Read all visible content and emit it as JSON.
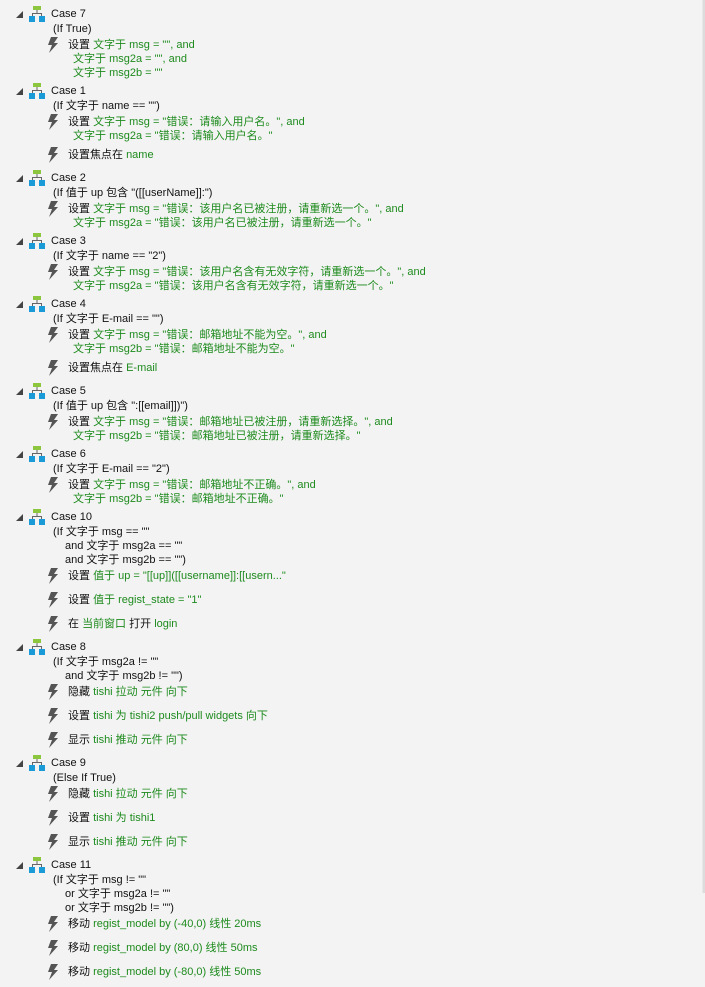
{
  "colors": {
    "background": "#f3f3f3",
    "keyword": "#111111",
    "value": "#1e8b1e",
    "case_icon_top": "#8cc63f",
    "case_icon_bottom": "#1a9ad6",
    "bolt": "#555555"
  },
  "cases": [
    {
      "label": "Case 7",
      "condition": [
        "(If True)"
      ],
      "actions": [
        {
          "lines": [
            [
              {
                "t": "设置 ",
                "c": "k"
              },
              {
                "t": "文字于 msg = \"\", and",
                "c": "g"
              }
            ],
            [
              {
                "t": " 文字于 msg2a = \"\", and",
                "c": "g"
              }
            ],
            [
              {
                "t": " 文字于 msg2b = \"\"",
                "c": "g"
              }
            ]
          ]
        }
      ]
    },
    {
      "label": "Case 1",
      "condition": [
        "(If 文字于 name == \"\")"
      ],
      "actions": [
        {
          "lines": [
            [
              {
                "t": "设置 ",
                "c": "k"
              },
              {
                "t": "文字于 msg = \"错误：请输入用户名。\", and",
                "c": "g"
              }
            ],
            [
              {
                "t": " 文字于 msg2a = \"错误：请输入用户名。\"",
                "c": "g"
              }
            ]
          ]
        },
        {
          "lines": [
            [
              {
                "t": "设置焦点在 ",
                "c": "k"
              },
              {
                "t": "name",
                "c": "g"
              }
            ]
          ]
        }
      ]
    },
    {
      "label": "Case 2",
      "condition": [
        "(If 值于 up 包含 \"([[userName]]:\")"
      ],
      "actions": [
        {
          "lines": [
            [
              {
                "t": "设置 ",
                "c": "k"
              },
              {
                "t": "文字于 msg = \"错误：该用户名已被注册，请重新选一个。\", and",
                "c": "g"
              }
            ],
            [
              {
                "t": " 文字于 msg2a = \"错误：该用户名已被注册，请重新选一个。\"",
                "c": "g"
              }
            ]
          ]
        }
      ]
    },
    {
      "label": "Case 3",
      "condition": [
        "(If 文字于 name == \"2\")"
      ],
      "actions": [
        {
          "lines": [
            [
              {
                "t": "设置 ",
                "c": "k"
              },
              {
                "t": "文字于 msg = \"错误：该用户名含有无效字符，请重新选一个。\", and",
                "c": "g"
              }
            ],
            [
              {
                "t": " 文字于 msg2a = \"错误：该用户名含有无效字符，请重新选一个。\"",
                "c": "g"
              }
            ]
          ]
        }
      ]
    },
    {
      "label": "Case 4",
      "condition": [
        "(If 文字于 E-mail == \"\")"
      ],
      "actions": [
        {
          "lines": [
            [
              {
                "t": "设置 ",
                "c": "k"
              },
              {
                "t": "文字于 msg = \"错误：邮箱地址不能为空。\", and",
                "c": "g"
              }
            ],
            [
              {
                "t": " 文字于 msg2b = \"错误：邮箱地址不能为空。\"",
                "c": "g"
              }
            ]
          ]
        },
        {
          "lines": [
            [
              {
                "t": "设置焦点在 ",
                "c": "k"
              },
              {
                "t": "E-mail",
                "c": "g"
              }
            ]
          ]
        }
      ]
    },
    {
      "label": "Case 5",
      "condition": [
        "(If 值于 up 包含 \":[[email]])\")"
      ],
      "actions": [
        {
          "lines": [
            [
              {
                "t": "设置 ",
                "c": "k"
              },
              {
                "t": "文字于 msg = \"错误：邮箱地址已被注册，请重新选择。\", and",
                "c": "g"
              }
            ],
            [
              {
                "t": " 文字于 msg2b = \"错误：邮箱地址已被注册，请重新选择。\"",
                "c": "g"
              }
            ]
          ]
        }
      ]
    },
    {
      "label": "Case 6",
      "condition": [
        "(If 文字于 E-mail == \"2\")"
      ],
      "actions": [
        {
          "lines": [
            [
              {
                "t": "设置 ",
                "c": "k"
              },
              {
                "t": "文字于 msg = \"错误：邮箱地址不正确。\", and",
                "c": "g"
              }
            ],
            [
              {
                "t": " 文字于 msg2b = \"错误：邮箱地址不正确。\"",
                "c": "g"
              }
            ]
          ]
        }
      ]
    },
    {
      "label": "Case 10",
      "condition": [
        "(If 文字于 msg == \"\"",
        "and 文字于 msg2a == \"\"",
        "and 文字于 msg2b == \"\")"
      ],
      "actions": [
        {
          "lines": [
            [
              {
                "t": "设置 ",
                "c": "k"
              },
              {
                "t": "值于 up = \"[[up]]([[username]]:[[usern...\"",
                "c": "g"
              }
            ]
          ]
        },
        {
          "lines": [
            [
              {
                "t": "设置 ",
                "c": "k"
              },
              {
                "t": "值于 regist_state = \"1\"",
                "c": "g"
              }
            ]
          ]
        },
        {
          "lines": [
            [
              {
                "t": "在 ",
                "c": "k"
              },
              {
                "t": "当前窗口",
                "c": "g"
              },
              {
                "t": " 打开 ",
                "c": "k"
              },
              {
                "t": "login",
                "c": "g"
              }
            ]
          ]
        }
      ]
    },
    {
      "label": "Case 8",
      "condition": [
        "(If 文字于 msg2a != \"\"",
        "and 文字于 msg2b != \"\")"
      ],
      "actions": [
        {
          "lines": [
            [
              {
                "t": "隐藏 ",
                "c": "k"
              },
              {
                "t": "tishi 拉动 元件 向下",
                "c": "g"
              }
            ]
          ]
        },
        {
          "lines": [
            [
              {
                "t": "设置 ",
                "c": "k"
              },
              {
                "t": "tishi 为 tishi2 push/pull widgets 向下",
                "c": "g"
              }
            ]
          ]
        },
        {
          "lines": [
            [
              {
                "t": "显示 ",
                "c": "k"
              },
              {
                "t": "tishi 推动 元件 向下",
                "c": "g"
              }
            ]
          ]
        }
      ]
    },
    {
      "label": "Case 9",
      "condition": [
        "(Else If True)"
      ],
      "actions": [
        {
          "lines": [
            [
              {
                "t": "隐藏 ",
                "c": "k"
              },
              {
                "t": "tishi 拉动 元件 向下",
                "c": "g"
              }
            ]
          ]
        },
        {
          "lines": [
            [
              {
                "t": "设置 ",
                "c": "k"
              },
              {
                "t": "tishi 为 tishi1",
                "c": "g"
              }
            ]
          ]
        },
        {
          "lines": [
            [
              {
                "t": "显示 ",
                "c": "k"
              },
              {
                "t": "tishi 推动 元件 向下",
                "c": "g"
              }
            ]
          ]
        }
      ]
    },
    {
      "label": "Case 11",
      "condition": [
        "(If 文字于 msg != \"\"",
        "or 文字于 msg2a != \"\"",
        "or 文字于 msg2b != \"\")"
      ],
      "actions": [
        {
          "lines": [
            [
              {
                "t": "移动 ",
                "c": "k"
              },
              {
                "t": "regist_model by (-40,0) 线性 20ms",
                "c": "g"
              }
            ]
          ]
        },
        {
          "lines": [
            [
              {
                "t": "移动 ",
                "c": "k"
              },
              {
                "t": "regist_model by (80,0) 线性 50ms",
                "c": "g"
              }
            ]
          ]
        },
        {
          "lines": [
            [
              {
                "t": "移动 ",
                "c": "k"
              },
              {
                "t": "regist_model by (-80,0) 线性 50ms",
                "c": "g"
              }
            ]
          ]
        }
      ]
    }
  ]
}
